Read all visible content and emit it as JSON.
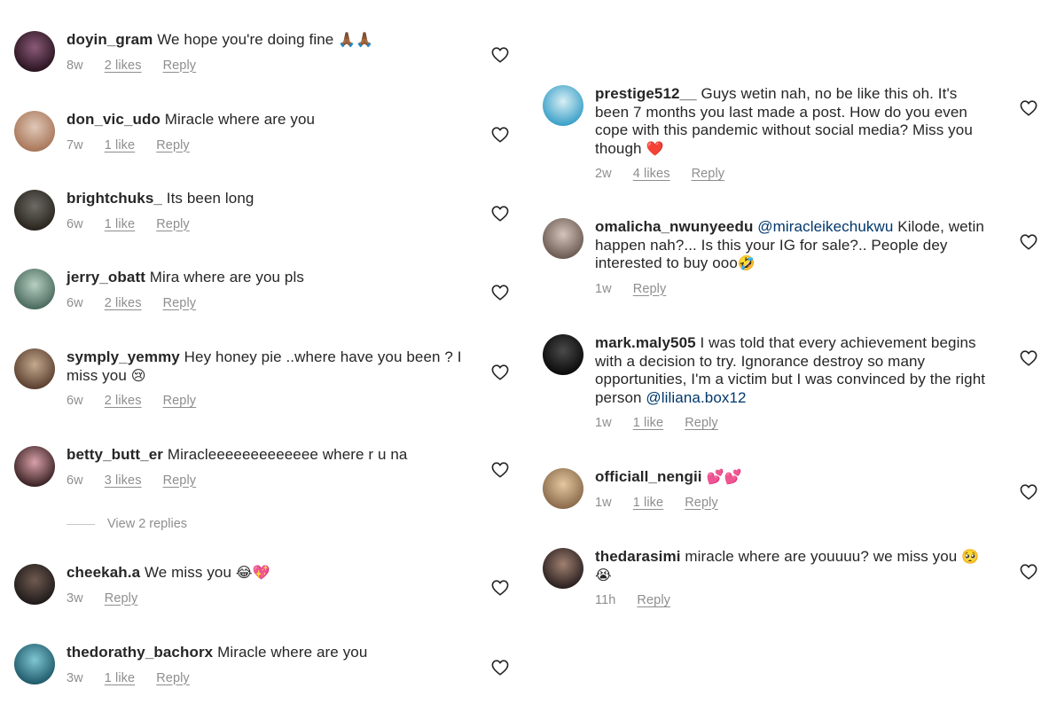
{
  "left": [
    {
      "username": "doyin_gram",
      "text": "We hope you're doing fine",
      "emoji": "🙏🏾🙏🏾",
      "time": "8w",
      "likes": "2 likes",
      "reply": "Reply",
      "avatar": [
        "#2a1420",
        "#8a5a78"
      ]
    },
    {
      "username": "don_vic_udo",
      "text": "Miracle where are you",
      "emoji": "",
      "time": "7w",
      "likes": "1 like",
      "reply": "Reply",
      "avatar": [
        "#a87658",
        "#e0c8b8"
      ]
    },
    {
      "username": "brightchuks_",
      "text": "Its been long",
      "emoji": "",
      "time": "6w",
      "likes": "1 like",
      "reply": "Reply",
      "avatar": [
        "#2a241e",
        "#6d6b66"
      ]
    },
    {
      "username": "jerry_obatt",
      "text": "Mira where are you pls",
      "emoji": "",
      "time": "6w",
      "likes": "2 likes",
      "reply": "Reply",
      "avatar": [
        "#4a6a5e",
        "#b6cfc0"
      ]
    },
    {
      "username": "symply_yemmy",
      "text": "Hey honey pie ..where have you been ? I miss you",
      "emoji": "😢",
      "time": "6w",
      "likes": "2 likes",
      "reply": "Reply",
      "avatar": [
        "#5b4030",
        "#c4a98e"
      ]
    },
    {
      "username": "betty_butt_er",
      "text": "Miracleeeeeeeeeeeee where r u na",
      "emoji": "",
      "time": "6w",
      "likes": "3 likes",
      "reply": "Reply",
      "avatar": [
        "#3a2224",
        "#d8a0a8"
      ]
    },
    {
      "username": "cheekah.a",
      "text": "We miss you",
      "emoji": "😂💖",
      "time": "3w",
      "likes": "",
      "reply": "Reply",
      "avatar": [
        "#1e1a1a",
        "#705a50"
      ]
    },
    {
      "username": "thedorathy_bachorx",
      "text": "Miracle where are you",
      "emoji": "",
      "time": "3w",
      "likes": "1 like",
      "reply": "Reply",
      "avatar": [
        "#1f5a6a",
        "#7fc6d2"
      ]
    }
  ],
  "view_replies": "View 2 replies",
  "right": [
    {
      "username": "prestige512__",
      "text": "Guys wetin nah, no be like this oh. It's been 7 months you last made a post. How do you even cope with this pandemic without social media? Miss you though",
      "mention": "",
      "tail": "",
      "emoji": "❤️",
      "time": "2w",
      "likes": "4 likes",
      "reply": "Reply",
      "avatar": [
        "#3aa0c8",
        "#d8eef4"
      ]
    },
    {
      "username": "omalicha_nwunyeedu",
      "text": "",
      "mention": "@miracleikechukwu",
      "tail": "Kilode, wetin happen nah?... Is this your IG for sale?.. People dey interested to buy ooo",
      "emoji": "🤣",
      "time": "1w",
      "likes": "",
      "reply": "Reply",
      "avatar": [
        "#6a5a52",
        "#d4c4bc"
      ]
    },
    {
      "username": "mark.maly505",
      "text": "I was told that every achievement begins with a decision to try. Ignorance destroy so many opportunities, I'm a victim but I was convinced by the right person",
      "mention": "@liliana.box12",
      "tail": "",
      "emoji": "",
      "time": "1w",
      "likes": "1 like",
      "reply": "Reply",
      "avatar": [
        "#0a0a0a",
        "#4a4a4a"
      ]
    },
    {
      "username": "officiall_nengii",
      "text": "",
      "mention": "",
      "tail": "",
      "emoji": "💕💕",
      "time": "1w",
      "likes": "1 like",
      "reply": "Reply",
      "avatar": [
        "#8a6a4a",
        "#e4c8a0"
      ]
    },
    {
      "username": "thedarasimi",
      "text": "miracle where are youuuu? we miss you",
      "mention": "",
      "tail": "",
      "emoji": "🥺😭",
      "time": "11h",
      "likes": "",
      "reply": "Reply",
      "avatar": [
        "#2a2020",
        "#a08070"
      ]
    }
  ],
  "colors": {
    "text": "#262626",
    "muted": "#8e8e8e",
    "mention": "#00376b",
    "heart": "#262626"
  },
  "icons": {
    "like": "heart-outline-icon"
  }
}
